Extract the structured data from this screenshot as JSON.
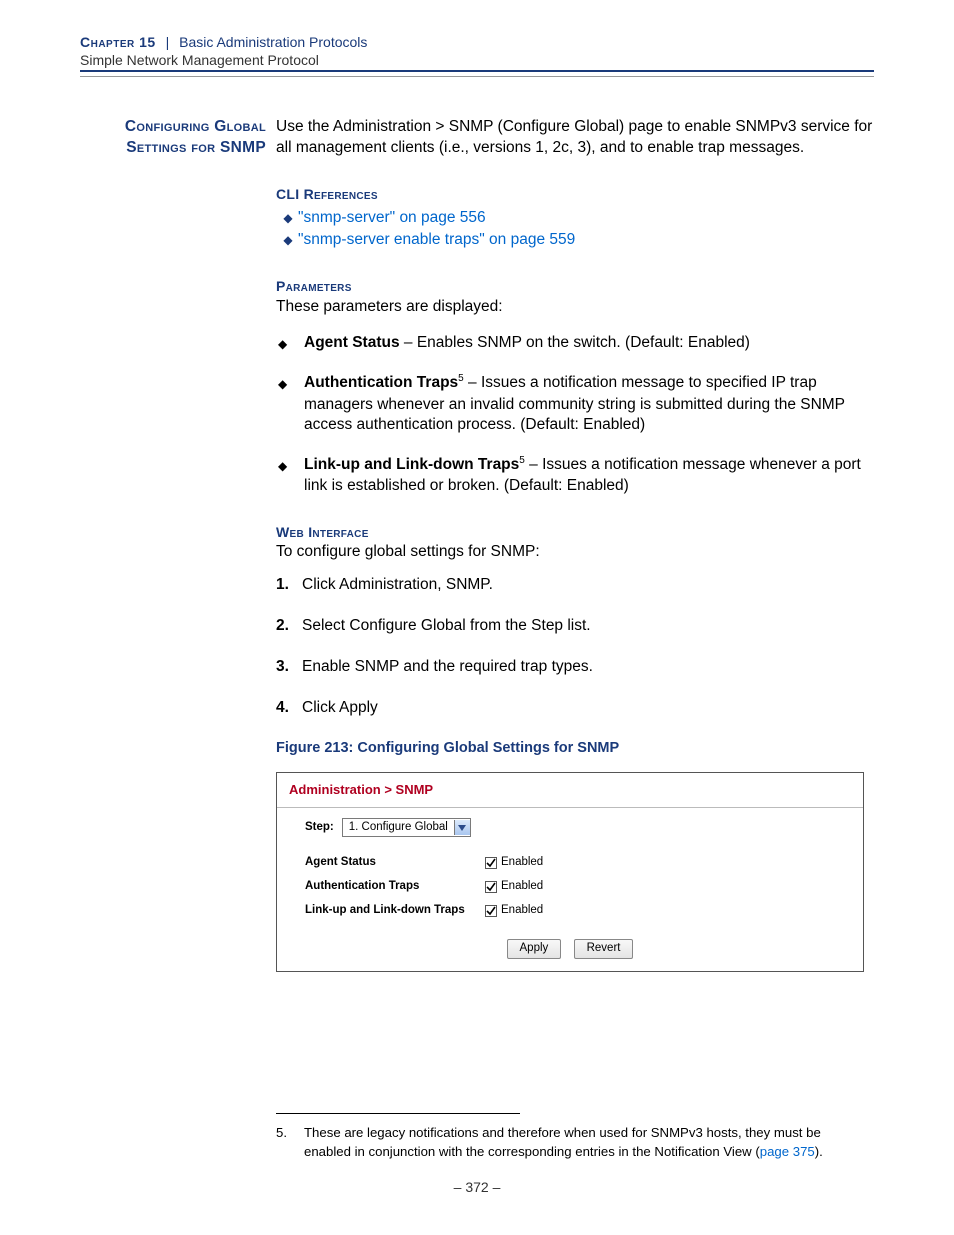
{
  "header": {
    "chapter_label": "Chapter 15",
    "separator": "|",
    "chapter_title": "Basic Administration Protocols",
    "section_title": "Simple Network Management Protocol"
  },
  "margin_heading": "Configuring Global Settings for SNMP",
  "intro": "Use the Administration > SNMP (Configure Global) page to enable SNMPv3 service for all management clients (i.e., versions 1, 2c, 3), and to enable trap messages.",
  "cli_references": {
    "label": "CLI References",
    "items": [
      "\"snmp-server\" on page 556",
      "\"snmp-server enable traps\" on page 559"
    ]
  },
  "parameters": {
    "label": "Parameters",
    "intro": "These parameters are displayed:",
    "items": [
      {
        "name": "Agent Status",
        "sup": "",
        "desc": " – Enables SNMP on the switch. (Default: Enabled)"
      },
      {
        "name": "Authentication Traps",
        "sup": "5",
        "desc": " – Issues a notification message to specified IP trap managers whenever an invalid community string is submitted during the SNMP access authentication process. (Default: Enabled)"
      },
      {
        "name": "Link-up and Link-down Traps",
        "sup": "5",
        "desc": " – Issues a notification message whenever a port link is established or broken. (Default: Enabled)"
      }
    ]
  },
  "web_interface": {
    "label": "Web Interface",
    "intro": "To configure global settings for SNMP:",
    "steps": [
      "Click Administration, SNMP.",
      "Select Configure Global from the Step list.",
      "Enable SNMP and the required trap types.",
      "Click Apply"
    ]
  },
  "figure": {
    "caption": "Figure 213:  Configuring Global Settings for SNMP",
    "breadcrumb": "Administration > SNMP",
    "step_label": "Step:",
    "step_value": "1. Configure Global",
    "rows": [
      {
        "label": "Agent Status",
        "value": "Enabled"
      },
      {
        "label": "Authentication Traps",
        "value": "Enabled"
      },
      {
        "label": "Link-up and Link-down Traps",
        "value": "Enabled"
      }
    ],
    "buttons": {
      "apply": "Apply",
      "revert": "Revert"
    }
  },
  "footnote": {
    "num": "5.",
    "text_a": "These are legacy notifications and therefore when used for SNMPv3 hosts, they must be enabled in conjunction with the corresponding entries in the Notification View (",
    "link": "page 375",
    "text_b": ")."
  },
  "page_number": "–  372  –"
}
